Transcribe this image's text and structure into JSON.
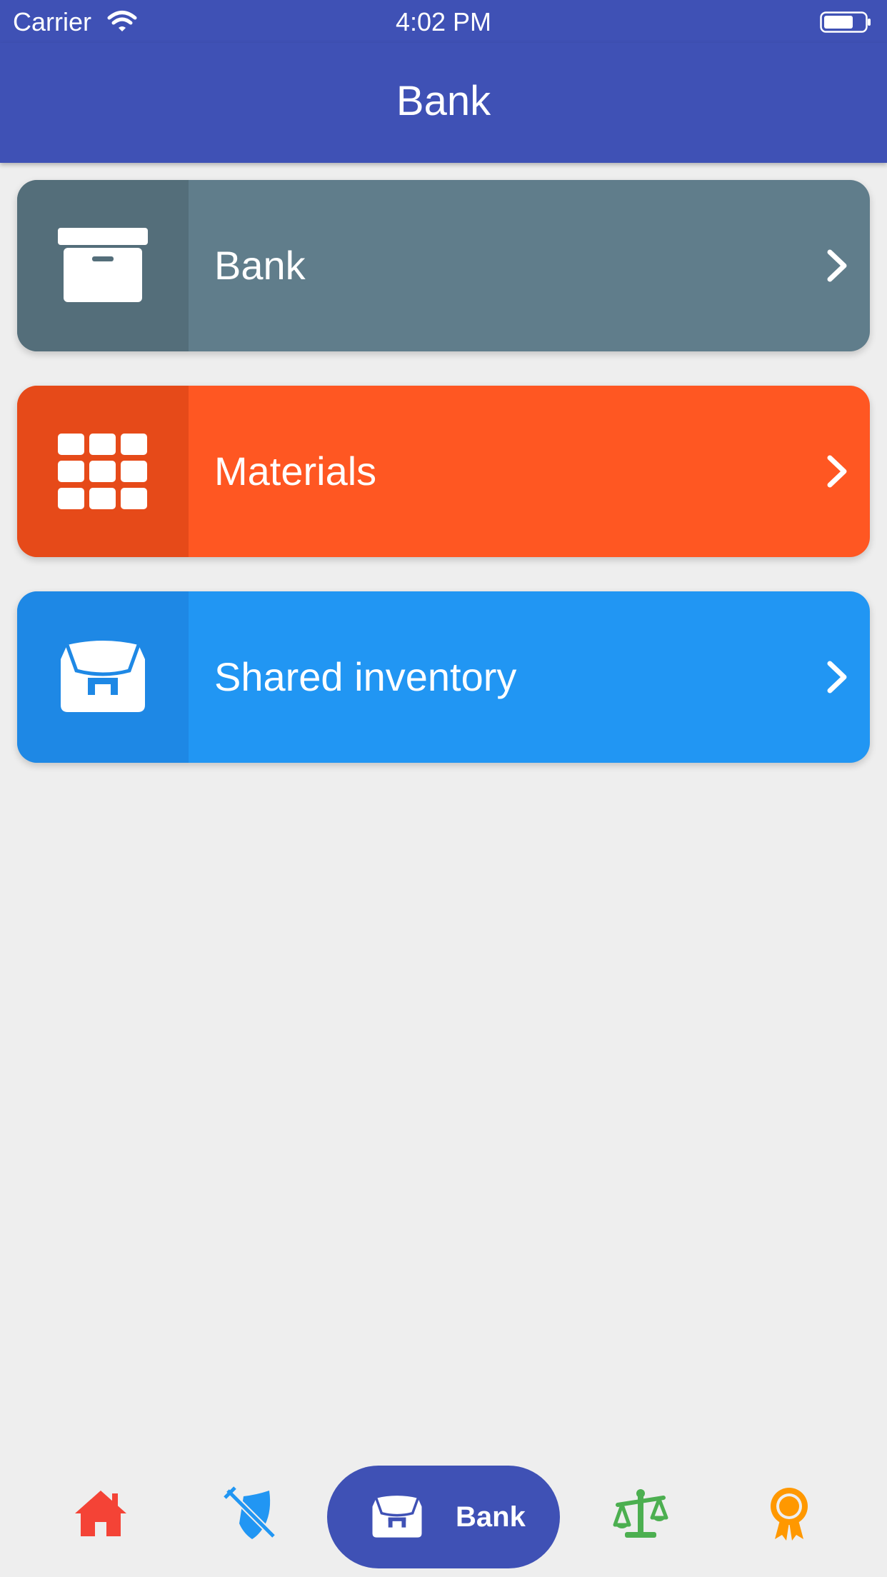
{
  "status_bar": {
    "carrier": "Carrier",
    "time": "4:02 PM"
  },
  "app_bar": {
    "title": "Bank"
  },
  "menu": [
    {
      "label": "Bank",
      "icon": "archive-box-icon",
      "color": "#607d8b",
      "icon_bg": "#546e7a"
    },
    {
      "label": "Materials",
      "icon": "grid-icon",
      "color": "#ff5722",
      "icon_bg": "#e64a19"
    },
    {
      "label": "Shared inventory",
      "icon": "bag-icon",
      "color": "#2196f3",
      "icon_bg": "#1e88e5"
    }
  ],
  "bottom_nav": {
    "items": [
      {
        "name": "home-icon",
        "color": "#f44336"
      },
      {
        "name": "sword-shield-icon",
        "color": "#2196f3"
      },
      {
        "name": "bag-icon",
        "color": "#ffffff",
        "active": true,
        "label": "Bank"
      },
      {
        "name": "scales-icon",
        "color": "#4caf50"
      },
      {
        "name": "award-ribbon-icon",
        "color": "#ff9800"
      }
    ],
    "active_label": "Bank",
    "active_color": "#3f51b5"
  }
}
